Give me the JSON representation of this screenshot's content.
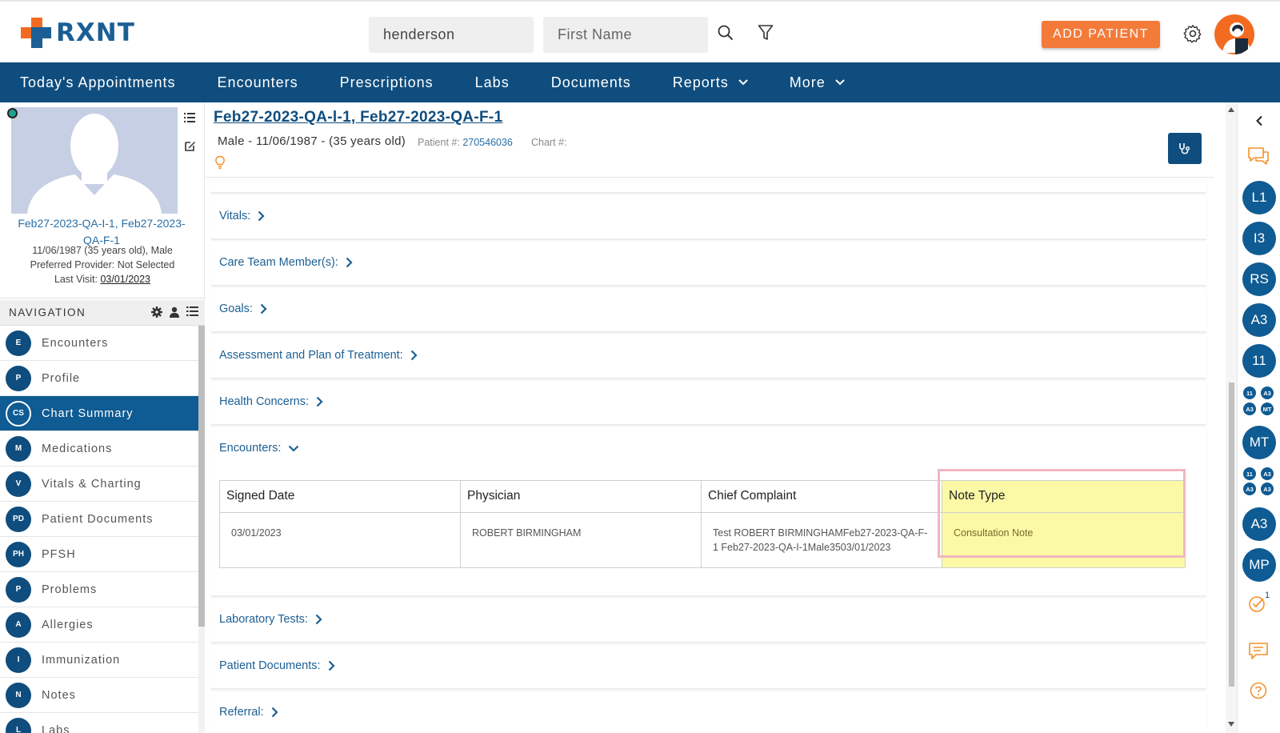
{
  "brand": {
    "name": "RXNT"
  },
  "header": {
    "last_name_value": "henderson",
    "first_name_placeholder": "First Name",
    "add_patient_label": "ADD PATIENT"
  },
  "nav": {
    "items": [
      {
        "label": "Today's Appointments"
      },
      {
        "label": "Encounters"
      },
      {
        "label": "Prescriptions"
      },
      {
        "label": "Labs"
      },
      {
        "label": "Documents"
      },
      {
        "label": "Reports"
      },
      {
        "label": "More"
      }
    ]
  },
  "patient_card": {
    "name": "Feb27-2023-QA-I-1, Feb27-2023-QA-F-1",
    "dob_line": "11/06/1987 (35 years old), Male",
    "provider_line": "Preferred Provider: Not Selected",
    "last_visit_label": "Last Visit:",
    "last_visit_value": "03/01/2023"
  },
  "navigation": {
    "title": "NAVIGATION",
    "items": [
      {
        "badge": "E",
        "label": "Encounters"
      },
      {
        "badge": "P",
        "label": "Profile"
      },
      {
        "badge": "CS",
        "label": "Chart Summary"
      },
      {
        "badge": "M",
        "label": "Medications"
      },
      {
        "badge": "V",
        "label": "Vitals & Charting"
      },
      {
        "badge": "PD",
        "label": "Patient Documents"
      },
      {
        "badge": "PH",
        "label": "PFSH"
      },
      {
        "badge": "P",
        "label": "Problems"
      },
      {
        "badge": "A",
        "label": "Allergies"
      },
      {
        "badge": "I",
        "label": "Immunization"
      },
      {
        "badge": "N",
        "label": "Notes"
      },
      {
        "badge": "L",
        "label": "Labs"
      }
    ]
  },
  "patient_header": {
    "title": "Feb27-2023-QA-l-1, Feb27-2023-QA-F-1",
    "subtitle": "Male - 11/06/1987 - (35 years old)",
    "patient_no_label": "Patient #:",
    "patient_no_value": "270546036",
    "chart_no_label": "Chart #:"
  },
  "sections": {
    "vitals": "Vitals:",
    "care_team": "Care Team Member(s):",
    "goals": "Goals:",
    "assessment": "Assessment and Plan of Treatment:",
    "health_concerns": "Health Concerns:",
    "encounters": "Encounters:",
    "lab_tests": "Laboratory Tests:",
    "patient_documents": "Patient Documents:",
    "referral": "Referral:"
  },
  "encounters_table": {
    "headers": [
      "Signed Date",
      "Physician",
      "Chief Complaint",
      "Note Type"
    ],
    "rows": [
      [
        "03/01/2023",
        "ROBERT BIRMINGHAM",
        "Test ROBERT BIRMINGHAMFeb27-2023-QA-F-1 Feb27-2023-QA-I-1Male3503/01/2023",
        "Consultation Note"
      ]
    ]
  },
  "rail": {
    "badges": [
      "L1",
      "I3",
      "RS",
      "A3",
      "11",
      "MT",
      "A3",
      "MP"
    ],
    "mini_group_1": [
      "11",
      "A3",
      "A3",
      "MT"
    ],
    "mini_group_2": [
      "11",
      "A3",
      "A3",
      "A3"
    ],
    "task_count": "1"
  },
  "colors": {
    "primary": "#0f4d7e",
    "accent": "#f26b21",
    "highlight": "#fbf9a6"
  }
}
